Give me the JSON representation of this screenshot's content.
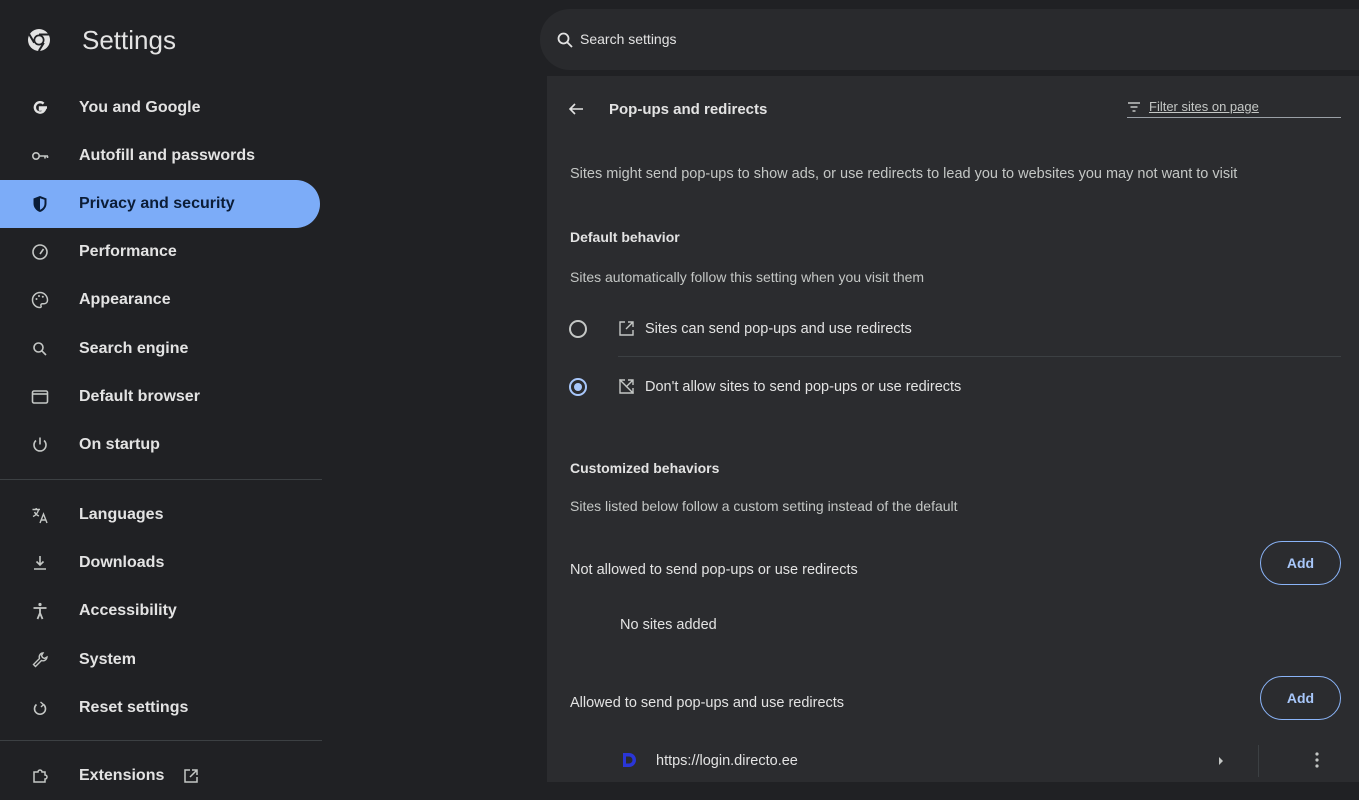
{
  "app": {
    "title": "Settings",
    "search_placeholder": "Search settings"
  },
  "sidebar": {
    "items": [
      {
        "label": "You and Google",
        "icon": "google-g-icon"
      },
      {
        "label": "Autofill and passwords",
        "icon": "key-icon"
      },
      {
        "label": "Privacy and security",
        "icon": "shield-icon",
        "active": true
      },
      {
        "label": "Performance",
        "icon": "speedometer-icon"
      },
      {
        "label": "Appearance",
        "icon": "palette-icon"
      },
      {
        "label": "Search engine",
        "icon": "search-icon"
      },
      {
        "label": "Default browser",
        "icon": "browser-window-icon"
      },
      {
        "label": "On startup",
        "icon": "power-icon"
      },
      {
        "label": "Languages",
        "icon": "translate-icon"
      },
      {
        "label": "Downloads",
        "icon": "download-icon"
      },
      {
        "label": "Accessibility",
        "icon": "accessibility-icon"
      },
      {
        "label": "System",
        "icon": "wrench-icon"
      },
      {
        "label": "Reset settings",
        "icon": "reset-icon"
      },
      {
        "label": "Extensions",
        "icon": "puzzle-icon"
      }
    ]
  },
  "main": {
    "title": "Pop-ups and redirects",
    "filter_placeholder": "Filter sites on page",
    "description": "Sites might send pop-ups to show ads, or use redirects to lead you to websites you may not want to visit",
    "default_behavior": {
      "heading": "Default behavior",
      "subtitle": "Sites automatically follow this setting when you visit them",
      "options": [
        {
          "label": "Sites can send pop-ups and use redirects",
          "icon": "open-in-new-icon",
          "checked": false
        },
        {
          "label": "Don't allow sites to send pop-ups or use redirects",
          "icon": "popup-blocked-icon",
          "checked": true
        }
      ]
    },
    "customized": {
      "heading": "Customized behaviors",
      "subtitle": "Sites listed below follow a custom setting instead of the default",
      "not_allowed_label": "Not allowed to send pop-ups or use redirects",
      "add_label": "Add",
      "empty_text": "No sites added",
      "allowed_label": "Allowed to send pop-ups and use redirects",
      "allowed_sites": [
        {
          "url": "https://login.directo.ee",
          "favicon": "directo-favicon"
        }
      ]
    }
  },
  "colors": {
    "accent": "#7cacf8",
    "link_blue": "#a8c7fa",
    "background": "#202124",
    "panel": "#2b2c2f"
  }
}
